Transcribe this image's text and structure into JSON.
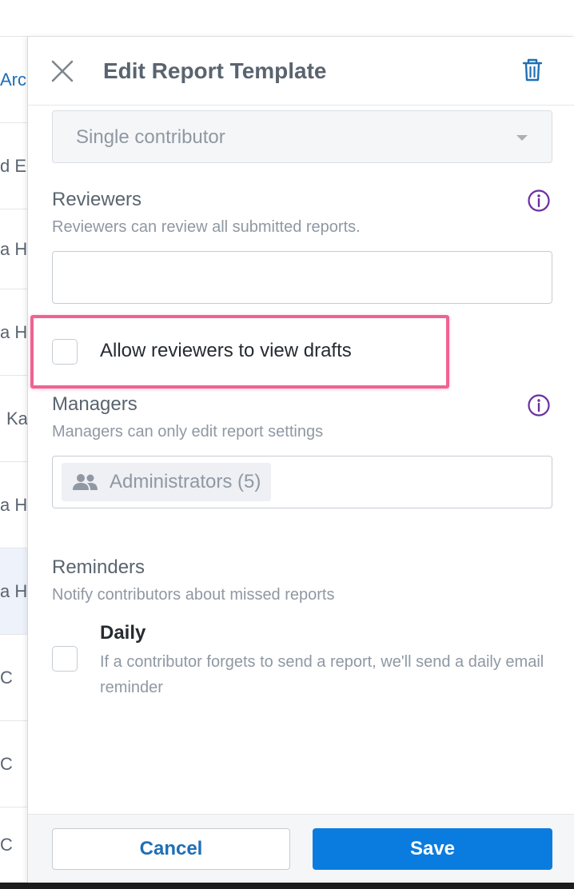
{
  "background_list": {
    "rows": [
      "Arc",
      "d E",
      "a H",
      "a H",
      "Ka",
      "a H",
      "a H",
      "C",
      "C",
      "C"
    ]
  },
  "panel": {
    "title": "Edit Report Template",
    "close_icon": "close-x-icon",
    "delete_icon": "trash-icon"
  },
  "contributor_mode": {
    "selected": "Single contributor"
  },
  "reviewers": {
    "title": "Reviewers",
    "description": "Reviewers can review all submitted reports.",
    "input_value": "",
    "allow_drafts_label": "Allow reviewers to view drafts",
    "allow_drafts_checked": false
  },
  "managers": {
    "title": "Managers",
    "description": "Managers can only edit report settings",
    "chip_label": "Administrators (5)",
    "chip_icon": "group-icon"
  },
  "reminders": {
    "title": "Reminders",
    "description": "Notify contributors about missed reports",
    "daily_title": "Daily",
    "daily_description": "If a contributor forgets to send a report, we'll send a daily email reminder",
    "daily_checked": false
  },
  "footer": {
    "cancel_label": "Cancel",
    "save_label": "Save"
  },
  "colors": {
    "accent": "#0a7ce0",
    "link": "#1f6fb5",
    "info_purple": "#6b2fa0",
    "highlight_pink": "#f06292"
  }
}
